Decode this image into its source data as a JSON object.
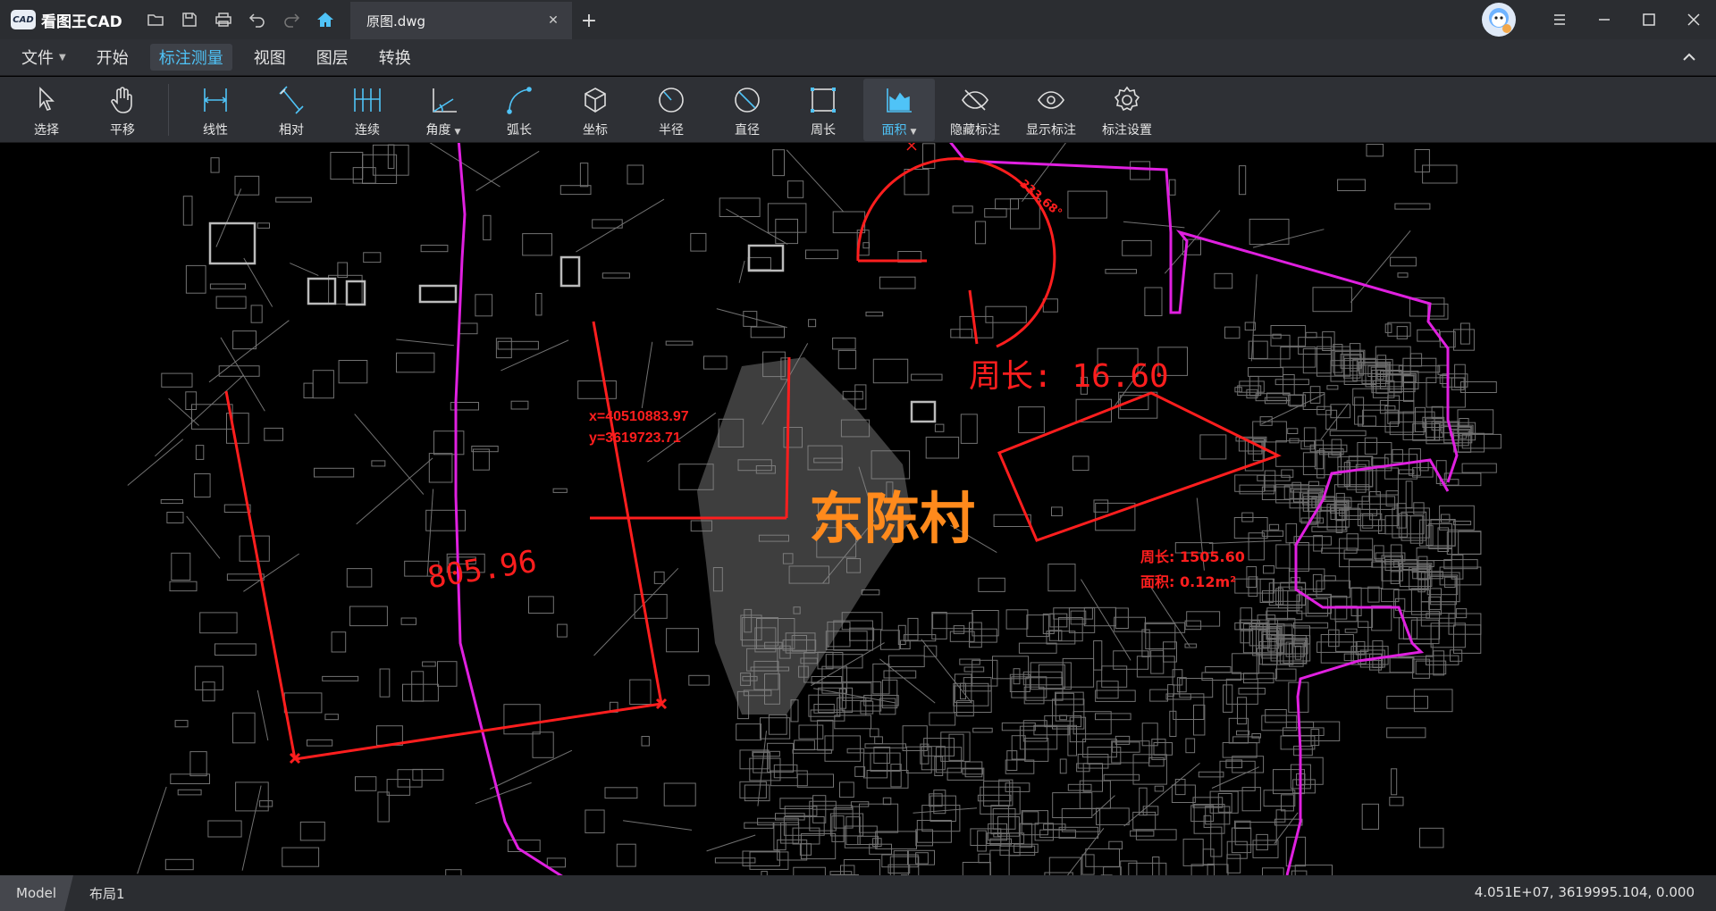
{
  "app": {
    "name": "看图王CAD",
    "logo_text": "CAD"
  },
  "document_tab": {
    "title": "原图.dwg",
    "close_glyph": "✕",
    "new_glyph": "+"
  },
  "titlebar_icons": [
    "open-folder-icon",
    "save-icon",
    "print-icon",
    "undo-icon",
    "redo-icon",
    "home-icon"
  ],
  "menu": {
    "items": [
      {
        "label": "文件",
        "has_caret": true
      },
      {
        "label": "开始"
      },
      {
        "label": "标注测量",
        "active": true
      },
      {
        "label": "视图"
      },
      {
        "label": "图层"
      },
      {
        "label": "转换"
      }
    ]
  },
  "ribbon": {
    "tools": [
      {
        "label": "选择",
        "icon": "cursor-icon"
      },
      {
        "label": "平移",
        "icon": "hand-icon"
      },
      {
        "label": "线性",
        "icon": "linear-dimension-icon"
      },
      {
        "label": "相对",
        "icon": "aligned-dimension-icon"
      },
      {
        "label": "连续",
        "icon": "continuous-dimension-icon"
      },
      {
        "label": "角度",
        "icon": "angle-icon",
        "dropdown": true
      },
      {
        "label": "弧长",
        "icon": "arc-length-icon"
      },
      {
        "label": "坐标",
        "icon": "coordinate-icon"
      },
      {
        "label": "半径",
        "icon": "radius-icon"
      },
      {
        "label": "直径",
        "icon": "diameter-icon"
      },
      {
        "label": "周长",
        "icon": "perimeter-icon"
      },
      {
        "label": "面积",
        "icon": "area-icon",
        "dropdown": true,
        "active": true
      },
      {
        "label": "隐藏标注",
        "icon": "eye-hidden-icon"
      },
      {
        "label": "显示标注",
        "icon": "eye-icon"
      },
      {
        "label": "标注设置",
        "icon": "gear-icon"
      }
    ]
  },
  "drawing": {
    "village_label": "东陈村",
    "linear_dimension": "805.96",
    "coord_x": "x=40510883.97",
    "coord_y": "y=3619723.71",
    "arc_angle": "333.68°",
    "perimeter_label": "周长: 16.60",
    "area_perimeter": "周长: 1505.60",
    "area_value": "面积: 0.12m²"
  },
  "status": {
    "tabs": [
      {
        "label": "Model",
        "active": true
      },
      {
        "label": "布局1"
      }
    ],
    "coordinates": "4.051E+07, 3619995.104, 0.000"
  },
  "colors": {
    "accent": "#4fc3f7",
    "measure_red": "#ff1e1e",
    "boundary_magenta": "#e020e0",
    "village_orange": "#ff8a1c"
  }
}
